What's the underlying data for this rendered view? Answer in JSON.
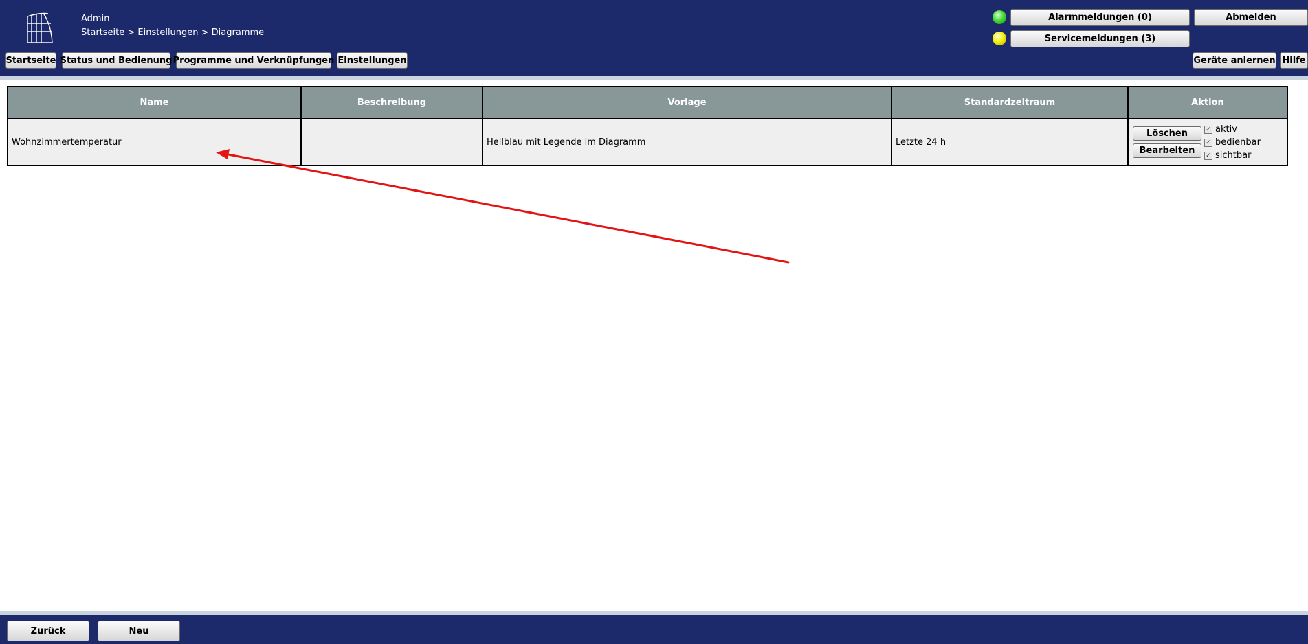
{
  "header": {
    "user": "Admin",
    "breadcrumb": "Startseite > Einstellungen > Diagramme",
    "nav": [
      "Startseite",
      "Status und Bedienung",
      "Programme und Verknüpfungen",
      "Einstellungen"
    ],
    "alarm_label": "Alarmmeldungen (0)",
    "service_label": "Servicemeldungen (3)",
    "logout_label": "Abmelden",
    "teach_label": "Geräte anlernen",
    "help_label": "Hilfe",
    "alarm_status_color": "#48d93a",
    "service_status_color": "#f3f00d"
  },
  "table": {
    "columns": [
      "Name",
      "Beschreibung",
      "Vorlage",
      "Standardzeitraum",
      "Aktion"
    ],
    "rows": [
      {
        "name": "Wohnzimmertemperatur",
        "description": "",
        "template": "Hellblau mit Legende im Diagramm",
        "period": "Letzte 24 h",
        "actions": {
          "delete": "Löschen",
          "edit": "Bearbeiten"
        },
        "flags": [
          {
            "label": "aktiv",
            "checked": true
          },
          {
            "label": "bedienbar",
            "checked": true
          },
          {
            "label": "sichtbar",
            "checked": true
          }
        ]
      }
    ]
  },
  "footer": {
    "back_label": "Zurück",
    "new_label": "Neu"
  },
  "annotation": {
    "color": "#e31414"
  }
}
